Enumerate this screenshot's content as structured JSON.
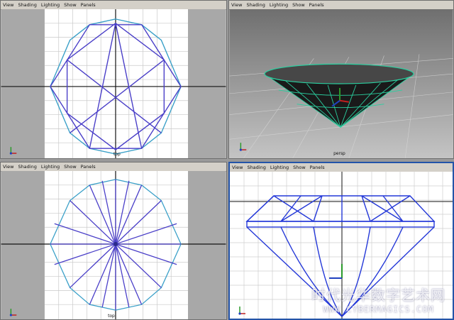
{
  "viewports": [
    {
      "id": "top-left",
      "menu": [
        "View",
        "Shading",
        "Lighting",
        "Show",
        "Panels"
      ],
      "camera_label": "top",
      "active": false
    },
    {
      "id": "top-right",
      "menu": [
        "View",
        "Shading",
        "Lighting",
        "Show",
        "Panels"
      ],
      "camera_label": "persp",
      "active": false
    },
    {
      "id": "bottom-left",
      "menu": [
        "View",
        "Shading",
        "Lighting",
        "Show",
        "Panels"
      ],
      "camera_label": "top",
      "active": false
    },
    {
      "id": "bottom-right",
      "menu": [
        "View",
        "Shading",
        "Lighting",
        "Show",
        "Panels"
      ],
      "camera_label": "",
      "active": true
    }
  ],
  "colors": {
    "wire": "#4a3fc8",
    "wire_light": "#3aa0c8",
    "persp_edge": "#2ad0a0",
    "active_border": "#2454a8"
  },
  "watermark": {
    "line1": "时代光华数字艺术网",
    "line2": "WWW.CYBERMAGICS.COM"
  }
}
